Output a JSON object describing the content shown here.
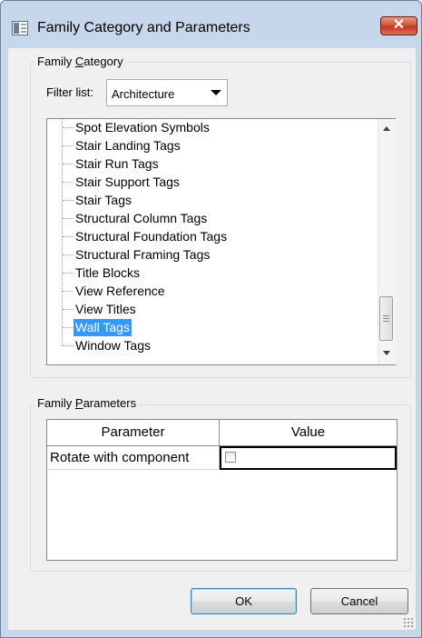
{
  "window": {
    "title": "Family Category and Parameters",
    "close_glyph": "✕",
    "app_icon": "revit-family-dialog-icon"
  },
  "family_category": {
    "group_label": "Family Category",
    "filter_label": "Filter list:",
    "filter_value": "Architecture",
    "items": [
      {
        "label": "Spot Elevation Symbols",
        "selected": false
      },
      {
        "label": "Stair Landing Tags",
        "selected": false
      },
      {
        "label": "Stair Run Tags",
        "selected": false
      },
      {
        "label": "Stair Support Tags",
        "selected": false
      },
      {
        "label": "Stair Tags",
        "selected": false
      },
      {
        "label": "Structural Column Tags",
        "selected": false
      },
      {
        "label": "Structural Foundation Tags",
        "selected": false
      },
      {
        "label": "Structural Framing Tags",
        "selected": false
      },
      {
        "label": "Title Blocks",
        "selected": false
      },
      {
        "label": "View Reference",
        "selected": false
      },
      {
        "label": "View Titles",
        "selected": false
      },
      {
        "label": "Wall Tags",
        "selected": true
      },
      {
        "label": "Window Tags",
        "selected": false
      }
    ]
  },
  "family_parameters": {
    "group_label": "Family Parameters",
    "columns": [
      "Parameter",
      "Value"
    ],
    "rows": [
      {
        "parameter": "Rotate with component",
        "value_checked": false
      }
    ]
  },
  "buttons": {
    "ok": "OK",
    "cancel": "Cancel"
  },
  "colors": {
    "selection": "#3399ff",
    "window_frame": "#c6d7ec",
    "close_button": "#c94a32"
  }
}
